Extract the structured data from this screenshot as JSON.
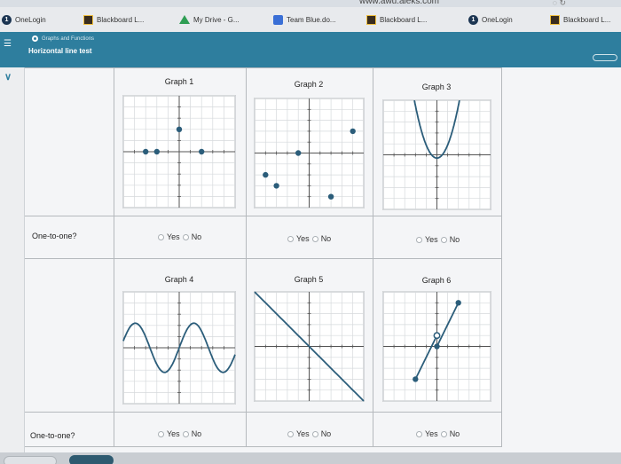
{
  "browser": {
    "url_fragment": "www.awu.aleks.com",
    "bookmarks": [
      {
        "label": "OneLogin",
        "icon": "onelogin-icon"
      },
      {
        "label": "Blackboard L...",
        "icon": "blackboard-icon"
      },
      {
        "label": "My Drive - G...",
        "icon": "google-drive-icon"
      },
      {
        "label": "Team Blue.do...",
        "icon": "google-docs-icon"
      },
      {
        "label": "Blackboard L...",
        "icon": "blackboard-icon"
      },
      {
        "label": "OneLogin",
        "icon": "onelogin-icon"
      },
      {
        "label": "Blackboard L...",
        "icon": "blackboard-icon"
      }
    ]
  },
  "header": {
    "topic": "Graphs and Functions",
    "title": "Horizontal line test",
    "accent_color": "#2e7e9e"
  },
  "question": {
    "row_label": "One-to-one?",
    "yes_label": "Yes",
    "no_label": "No"
  },
  "graphs": [
    {
      "title": "Graph 1",
      "kind": "points",
      "points": [
        [
          -3,
          0
        ],
        [
          -2,
          0
        ],
        [
          2,
          0
        ],
        [
          0,
          2
        ]
      ],
      "open_points": []
    },
    {
      "title": "Graph 2",
      "kind": "points",
      "points": [
        [
          -4,
          -2
        ],
        [
          -3,
          -3
        ],
        [
          -1,
          0
        ],
        [
          2,
          -4
        ],
        [
          4,
          2
        ]
      ],
      "open_points": []
    },
    {
      "title": "Graph 3",
      "kind": "parabola",
      "points": [],
      "open_points": []
    },
    {
      "title": "Graph 4",
      "kind": "sine",
      "points": [],
      "open_points": []
    },
    {
      "title": "Graph 5",
      "kind": "line",
      "points": [],
      "open_points": []
    },
    {
      "title": "Graph 6",
      "kind": "two-segments",
      "points": [
        [
          -2,
          -3
        ],
        [
          0,
          0
        ],
        [
          2,
          4
        ]
      ],
      "open_points": [
        [
          0,
          1
        ]
      ]
    }
  ]
}
